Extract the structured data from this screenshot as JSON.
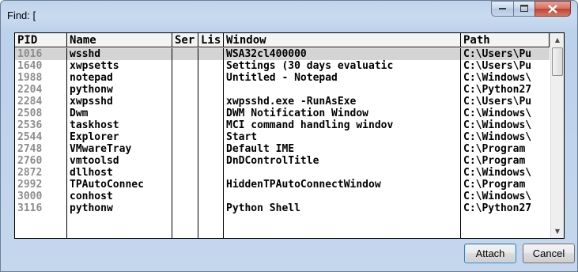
{
  "window": {
    "title": "Find: ["
  },
  "columns": [
    "PID",
    "Name",
    "Ser",
    "Lis",
    "Window",
    "Path"
  ],
  "rows": [
    {
      "pid": "1016",
      "name": "wsshd",
      "window": "WSA32cl400000",
      "path": "C:\\Users\\Pu",
      "selected": true
    },
    {
      "pid": "1640",
      "name": "xwpsetts",
      "window": "Settings (30 days evaluatic",
      "path": "C:\\Users\\Pu"
    },
    {
      "pid": "1988",
      "name": "notepad",
      "window": "Untitled - Notepad",
      "path": "C:\\Windows\\"
    },
    {
      "pid": "2204",
      "name": "pythonw",
      "window": "",
      "path": "C:\\Python27"
    },
    {
      "pid": "2284",
      "name": "xwpsshd",
      "window": "xwpsshd.exe -RunAsExe",
      "path": "C:\\Users\\Pu"
    },
    {
      "pid": "2508",
      "name": "Dwm",
      "window": "DWM Notification Window",
      "path": "C:\\Windows\\"
    },
    {
      "pid": "2536",
      "name": "taskhost",
      "window": "MCI command handling windov",
      "path": "C:\\Windows\\"
    },
    {
      "pid": "2544",
      "name": "Explorer",
      "window": "Start",
      "path": "C:\\Windows\\"
    },
    {
      "pid": "2748",
      "name": "VMwareTray",
      "window": "Default IME",
      "path": "C:\\Program"
    },
    {
      "pid": "2760",
      "name": "vmtoolsd",
      "window": "DnDControlTitle",
      "path": "C:\\Program"
    },
    {
      "pid": "2872",
      "name": "dllhost",
      "window": "",
      "path": "C:\\Windows\\"
    },
    {
      "pid": "2992",
      "name": "TPAutoConnec",
      "window": "HiddenTPAutoConnectWindow",
      "path": "C:\\Program"
    },
    {
      "pid": "3000",
      "name": "conhost",
      "window": "",
      "path": "C:\\Windows\\"
    },
    {
      "pid": "3116",
      "name": "pythonw",
      "window": "Python Shell",
      "path": "C:\\Python27"
    }
  ],
  "buttons": {
    "attach": "Attach",
    "cancel": "Cancel"
  }
}
